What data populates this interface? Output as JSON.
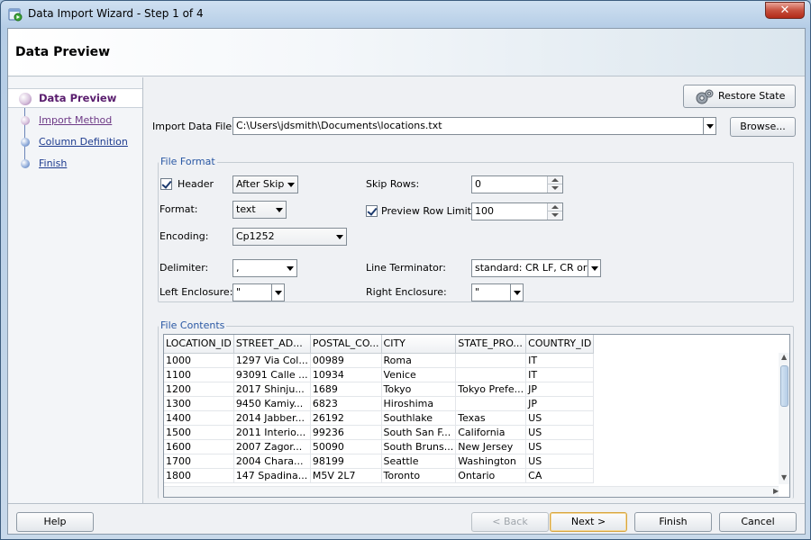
{
  "window": {
    "title": "Data Import Wizard - Step 1 of 4",
    "close_glyph": "✕",
    "accent": "#2a58a4"
  },
  "header": {
    "title": "Data Preview"
  },
  "steps": [
    {
      "label": "Data Preview",
      "state": "current"
    },
    {
      "label": "Import Method",
      "state": "visited"
    },
    {
      "label": "Column Definition",
      "state": "pending"
    },
    {
      "label": "Finish",
      "state": "pending"
    }
  ],
  "toolbar": {
    "restore_state_label": "Restore State",
    "restore_icon": "gears-icon"
  },
  "import_file": {
    "label": "Import Data File:",
    "value": "C:\\Users\\jdsmith\\Documents\\locations.txt",
    "browse_label": "Browse..."
  },
  "file_format": {
    "title": "File Format",
    "header_label": "Header",
    "header_checked": true,
    "header_mode": "After Skip",
    "skip_rows_label": "Skip Rows:",
    "skip_rows_value": "0",
    "format_label": "Format:",
    "format_value": "text",
    "preview_limit_label": "Preview Row Limit:",
    "preview_limit_checked": true,
    "preview_limit_value": "100",
    "encoding_label": "Encoding:",
    "encoding_value": "Cp1252",
    "delimiter_label": "Delimiter:",
    "delimiter_value": ",",
    "line_terminator_label": "Line Terminator:",
    "line_terminator_value": "standard: CR LF, CR or LF",
    "left_enclosure_label": "Left Enclosure:",
    "left_enclosure_value": "\"",
    "right_enclosure_label": "Right Enclosure:",
    "right_enclosure_value": "\""
  },
  "file_contents": {
    "title": "File Contents",
    "columns": [
      "LOCATION_ID",
      "STREET_AD...",
      "POSTAL_CO...",
      "CITY",
      "STATE_PRO...",
      "COUNTRY_ID"
    ],
    "rows": [
      [
        "1000",
        "1297 Via Col...",
        "00989",
        "Roma",
        "",
        "IT"
      ],
      [
        "1100",
        "93091 Calle ...",
        "10934",
        "Venice",
        "",
        "IT"
      ],
      [
        "1200",
        "2017 Shinju...",
        "1689",
        "Tokyo",
        "Tokyo Prefe...",
        "JP"
      ],
      [
        "1300",
        "9450 Kamiy...",
        "6823",
        "Hiroshima",
        "",
        "JP"
      ],
      [
        "1400",
        "2014 Jabber...",
        "26192",
        "Southlake",
        "Texas",
        "US"
      ],
      [
        "1500",
        "2011 Interio...",
        "99236",
        "South San F...",
        "California",
        "US"
      ],
      [
        "1600",
        "2007 Zagor...",
        "50090",
        "South Bruns...",
        "New Jersey",
        "US"
      ],
      [
        "1700",
        "2004 Chara...",
        "98199",
        "Seattle",
        "Washington",
        "US"
      ],
      [
        "1800",
        "147 Spadina...",
        "M5V 2L7",
        "Toronto",
        "Ontario",
        "CA"
      ]
    ]
  },
  "buttons": {
    "help": "Help",
    "back": "< Back",
    "next": "Next >",
    "finish": "Finish",
    "cancel": "Cancel"
  }
}
